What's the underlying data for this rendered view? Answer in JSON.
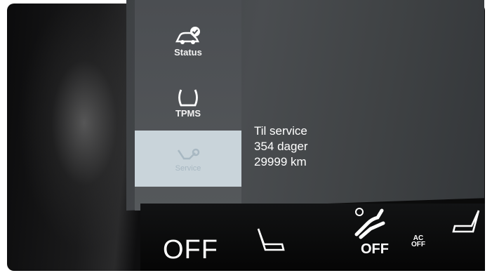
{
  "sidebar": {
    "items": [
      {
        "label": "Status",
        "icon": "car-check-icon"
      },
      {
        "label": "TPMS",
        "icon": "tire-pressure-icon"
      },
      {
        "label": "Service",
        "icon": "service-icon",
        "active": true
      }
    ]
  },
  "service_info": {
    "line1": "Til service",
    "line2": "354 dager",
    "line3": "29999 km"
  },
  "climate_bar": {
    "left_off": "OFF",
    "fan_off": "OFF",
    "ac_top": "AC",
    "ac_bottom": "OFF"
  },
  "colors": {
    "panel": "#4a4d50",
    "active_item": "#c9d4da",
    "text": "#ffffff"
  }
}
